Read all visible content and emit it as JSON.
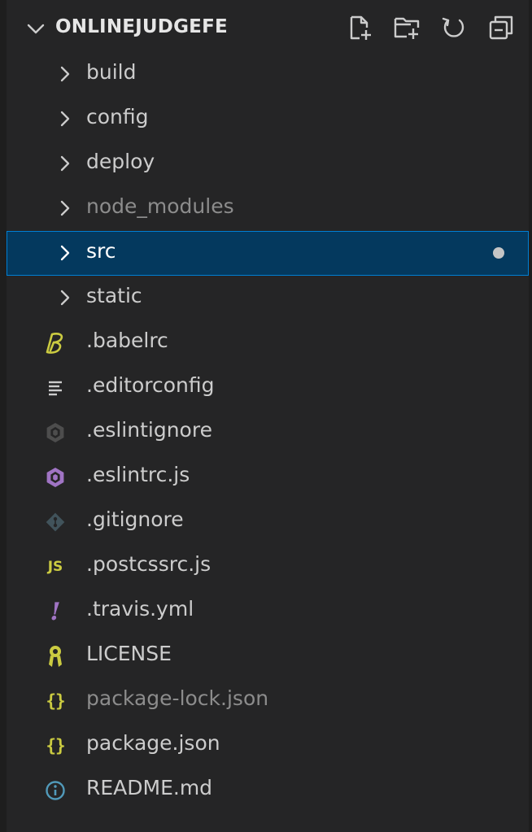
{
  "explorer": {
    "title": "ONLINEJUDGEFE",
    "actions": [
      {
        "name": "new-file-icon"
      },
      {
        "name": "new-folder-icon"
      },
      {
        "name": "refresh-icon"
      },
      {
        "name": "collapse-all-icon"
      }
    ]
  },
  "tree": {
    "folders": [
      {
        "label": "build"
      },
      {
        "label": "config"
      },
      {
        "label": "deploy"
      },
      {
        "label": "node_modules"
      },
      {
        "label": "src"
      },
      {
        "label": "static"
      }
    ],
    "files": [
      {
        "label": ".babelrc"
      },
      {
        "label": ".editorconfig"
      },
      {
        "label": ".eslintignore"
      },
      {
        "label": ".eslintrc.js"
      },
      {
        "label": ".gitignore"
      },
      {
        "label": ".postcssrc.js",
        "icon_text": "JS"
      },
      {
        "label": ".travis.yml",
        "icon_text": "!"
      },
      {
        "label": "LICENSE"
      },
      {
        "label": "package-lock.json",
        "icon_text": "{}"
      },
      {
        "label": "package.json",
        "icon_text": "{}"
      },
      {
        "label": "README.md"
      }
    ]
  },
  "colors": {
    "background": "#252526",
    "selected_bg": "#04395e",
    "selected_border": "#007fd4",
    "text": "#cccccc",
    "dim_text": "#8c8c8c",
    "yellow": "#cbcb41",
    "purple": "#a074c4",
    "info_blue": "#519aba"
  }
}
